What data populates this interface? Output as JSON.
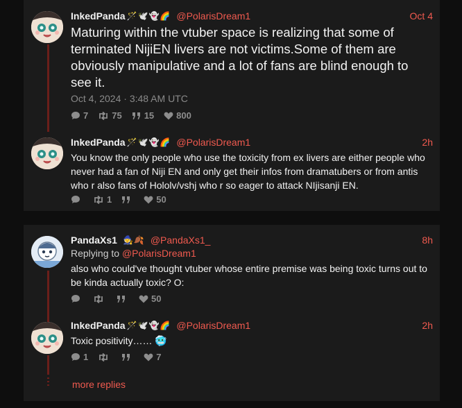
{
  "colors": {
    "background": "#0e0e0e",
    "card": "#1b1b1b",
    "accent": "#f05a4f",
    "thread_line": "#6b1f1a",
    "muted": "#8d8d8d"
  },
  "thread1": {
    "post": {
      "name": "InkedPanda",
      "emojis": "🪄🕊️👻🌈",
      "handle": "@PolarisDream1",
      "time": "Oct 4",
      "text": "Maturing within the vtuber space is realizing that some of terminated NijiEN livers are not victims.Some of them are obviously manipulative and a lot of fans are blind enough to see it.",
      "timestamp": "Oct 4, 2024 · 3:48 AM UTC",
      "replies": "7",
      "retweets": "75",
      "quotes": "15",
      "likes": "800"
    },
    "reply": {
      "name": "InkedPanda",
      "emojis": "🪄🕊️👻🌈",
      "handle": "@PolarisDream1",
      "time": "2h",
      "text": "You know the only people who use the toxicity from ex livers are either people who never had a fan of Niji EN and only get their infos from dramatubers or from antis who r also fans of Hololv/vshj who r so eager to attack NIjisanji EN.",
      "replies": "",
      "retweets": "1",
      "quotes": "",
      "likes": "50"
    }
  },
  "thread2": {
    "post": {
      "name": "PandaXs1",
      "emojis": "🧙🍂",
      "handle": "@PandaXs1_",
      "time": "8h",
      "replying_label": "Replying to",
      "replying_handle": "@PolarisDream1",
      "text": "also who could've thought vtuber whose entire premise was being toxic turns out to be kinda actually toxic? O:",
      "replies": "",
      "retweets": "",
      "quotes": "",
      "likes": "50"
    },
    "reply": {
      "name": "InkedPanda",
      "emojis": "🪄🕊️👻🌈",
      "handle": "@PolarisDream1",
      "time": "2h",
      "text": "Toxic positivity…… 🥶",
      "replies": "1",
      "retweets": "",
      "quotes": "",
      "likes": "7"
    },
    "more_replies": "more replies"
  }
}
